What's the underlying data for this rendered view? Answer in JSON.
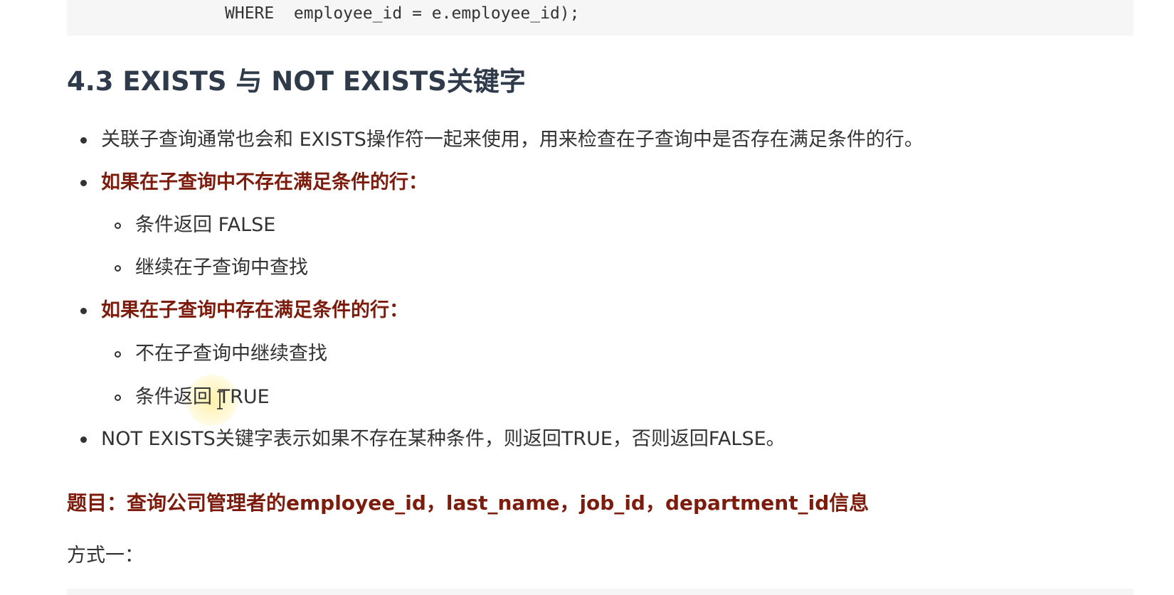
{
  "code_top": {
    "line": "WHERE  employee_id = e.employee_id);"
  },
  "section": {
    "heading": "4.3 EXISTS 与 NOT EXISTS关键字"
  },
  "items": {
    "intro": "关联子查询通常也会和 EXISTS操作符一起来使用，用来检查在子查询中是否存在满足条件的行。",
    "not_exist_title": "如果在子查询中不存在满足条件的行：",
    "not_exist_1": "条件返回 FALSE",
    "not_exist_2": "继续在子查询中查找",
    "exist_title": "如果在子查询中存在满足条件的行：",
    "exist_1": "不在子查询中继续查找",
    "exist_2": "条件返回 TRUE",
    "not_exists_note": "NOT EXISTS关键字表示如果不存在某种条件，则返回TRUE，否则返回FALSE。"
  },
  "question": {
    "text": "题目：查询公司管理者的employee_id，last_name，job_id，department_id信息"
  },
  "method": {
    "label": "方式一："
  },
  "icons": {
    "cursor": "text-cursor-icon"
  }
}
